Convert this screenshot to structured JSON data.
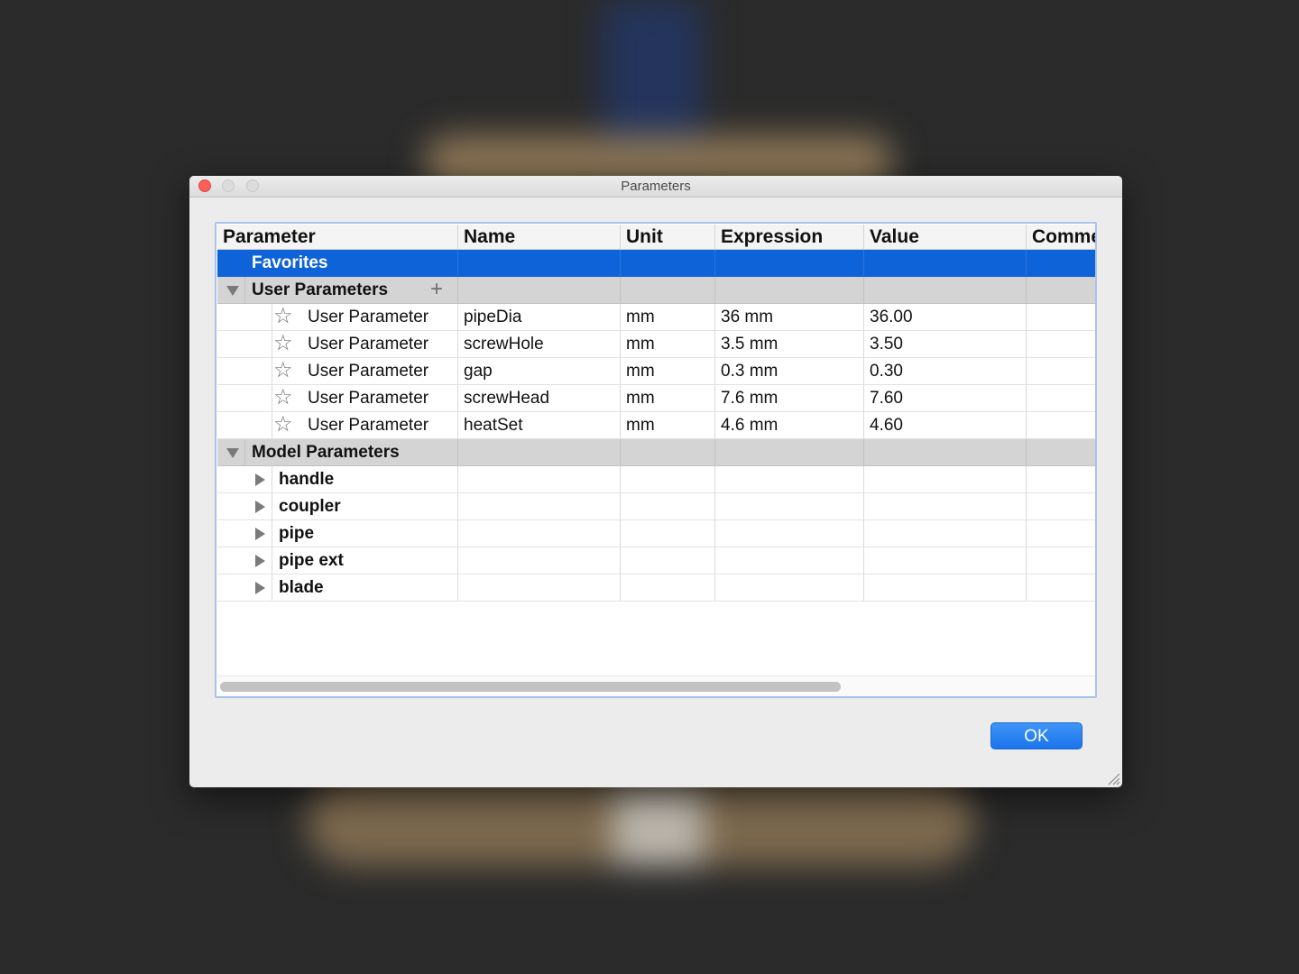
{
  "window": {
    "title": "Parameters"
  },
  "columns": [
    {
      "key": "param",
      "label": "Parameter"
    },
    {
      "key": "name",
      "label": "Name"
    },
    {
      "key": "unit",
      "label": "Unit"
    },
    {
      "key": "expr",
      "label": "Expression"
    },
    {
      "key": "value",
      "label": "Value"
    },
    {
      "key": "comment",
      "label": "Comme"
    }
  ],
  "favorites": {
    "label": "Favorites"
  },
  "user_parameters": {
    "label": "User Parameters",
    "rows": [
      {
        "parameter": "User Parameter",
        "name": "pipeDia",
        "unit": "mm",
        "expression": "36 mm",
        "value": "36.00"
      },
      {
        "parameter": "User Parameter",
        "name": "screwHole",
        "unit": "mm",
        "expression": "3.5 mm",
        "value": "3.50"
      },
      {
        "parameter": "User Parameter",
        "name": "gap",
        "unit": "mm",
        "expression": "0.3 mm",
        "value": "0.30"
      },
      {
        "parameter": "User Parameter",
        "name": "screwHead",
        "unit": "mm",
        "expression": "7.6 mm",
        "value": "7.60"
      },
      {
        "parameter": "User Parameter",
        "name": "heatSet",
        "unit": "mm",
        "expression": "4.6 mm",
        "value": "4.60"
      }
    ]
  },
  "model_parameters": {
    "label": "Model Parameters",
    "components": [
      "handle",
      "coupler",
      "pipe",
      "pipe ext",
      "blade"
    ]
  },
  "buttons": {
    "ok": "OK"
  },
  "colors": {
    "selection": "#0f63d8",
    "ok_button": "#1a74ec",
    "close_button": "#fc5f57"
  }
}
